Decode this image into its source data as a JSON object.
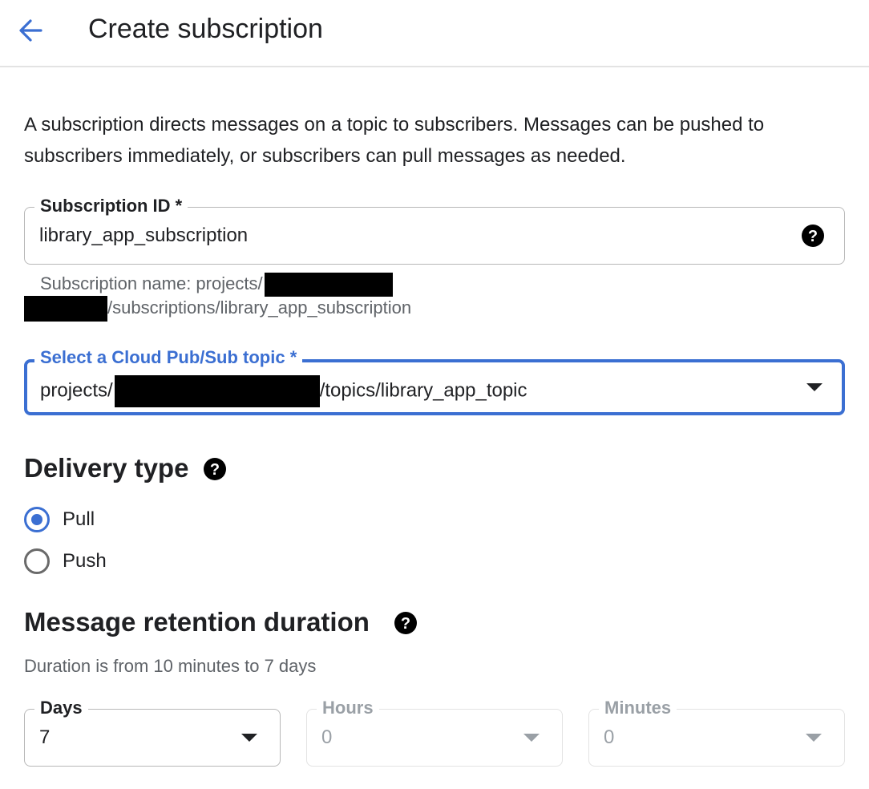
{
  "header": {
    "title": "Create subscription"
  },
  "intro": "A subscription directs messages on a topic to subscribers. Messages can be pushed to subscribers immediately, or subscribers can pull messages as needed.",
  "subscription_id": {
    "label": "Subscription ID *",
    "value": "library_app_subscription",
    "hint_prefix": "Subscription name: projects/",
    "hint_suffix": "/subscriptions/library_app_subscription"
  },
  "topic": {
    "label": "Select a Cloud Pub/Sub topic *",
    "value_prefix": "projects/",
    "value_suffix": "/topics/library_app_topic"
  },
  "delivery": {
    "title": "Delivery type",
    "options": [
      {
        "label": "Pull",
        "selected": true
      },
      {
        "label": "Push",
        "selected": false
      }
    ]
  },
  "retention": {
    "title": "Message retention duration",
    "hint": "Duration is from 10 minutes to 7 days",
    "days": {
      "label": "Days",
      "value": "7"
    },
    "hours": {
      "label": "Hours",
      "value": "0"
    },
    "minutes": {
      "label": "Minutes",
      "value": "0"
    }
  },
  "colors": {
    "accent": "#3b6fd2",
    "text": "#202124",
    "muted": "#5f6368",
    "redaction": "#000000"
  },
  "icons": [
    "back-arrow-icon",
    "help-icon",
    "caret-down-icon"
  ]
}
